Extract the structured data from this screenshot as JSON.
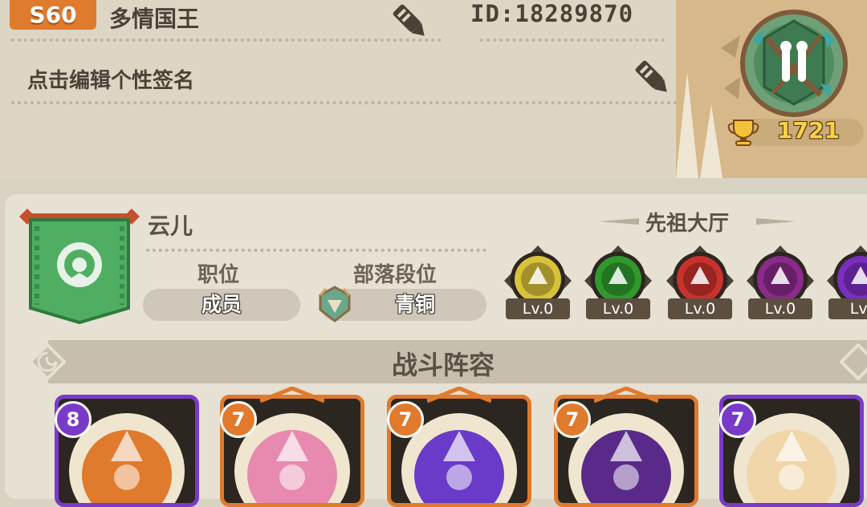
{
  "profile": {
    "level": "S60",
    "name": "多情国王",
    "id_text": "ID:18289870",
    "signature": "点击编辑个性签名"
  },
  "rank": {
    "trophies": "1721",
    "emblem_icon": "rank-emblem-icon"
  },
  "clan": {
    "name": "云儿",
    "position_label": "职位",
    "position_value": "成员",
    "tier_label": "部落段位",
    "tier_value": "青铜"
  },
  "ancestor_hall": {
    "title": "先祖大厅",
    "items": [
      {
        "level": "Lv.0",
        "color": "#d8c23a"
      },
      {
        "level": "Lv.0",
        "color": "#2f9a2c"
      },
      {
        "level": "Lv.0",
        "color": "#c9312c"
      },
      {
        "level": "Lv.0",
        "color": "#8a2a8a"
      },
      {
        "level": "Lv.",
        "color": "#7a2ec0"
      }
    ]
  },
  "lineup": {
    "title": "战斗阵容",
    "heroes": [
      {
        "star": "8",
        "badge_color": "#7a3ac8",
        "frame": "#7a3ac8",
        "art": "#e07a2c"
      },
      {
        "star": "7",
        "badge_color": "#e07a2c",
        "frame": "#e07a2c",
        "art": "#e889b0"
      },
      {
        "star": "7",
        "badge_color": "#e07a2c",
        "frame": "#e07a2c",
        "art": "#6a3ac8"
      },
      {
        "star": "7",
        "badge_color": "#e07a2c",
        "frame": "#e07a2c",
        "art": "#5a2a8a"
      },
      {
        "star": "7",
        "badge_color": "#7a3ac8",
        "frame": "#7a3ac8",
        "art": "#f0d6a8"
      }
    ]
  }
}
